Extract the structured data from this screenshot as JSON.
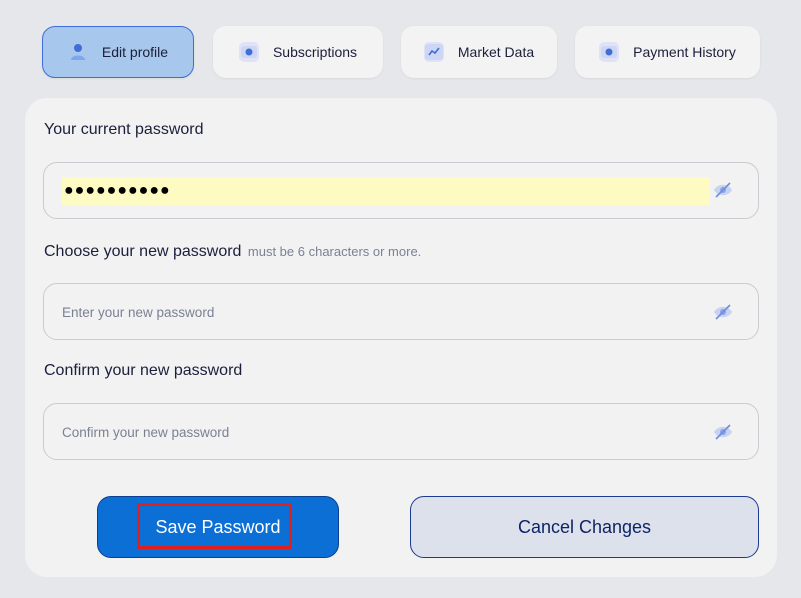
{
  "tabs": [
    {
      "label": "Edit profile",
      "icon": "user-icon",
      "active": true
    },
    {
      "label": "Subscriptions",
      "icon": "card-icon",
      "active": false
    },
    {
      "label": "Market Data",
      "icon": "chart-line-icon",
      "active": false
    },
    {
      "label": "Payment History",
      "icon": "card-icon",
      "active": false
    }
  ],
  "current": {
    "label": "Your current password",
    "masked_value": "●●●●●●●●●●"
  },
  "new": {
    "label": "Choose your new password",
    "hint": "must be 6 characters or more.",
    "placeholder": "Enter your new password"
  },
  "confirm": {
    "label": "Confirm your new password",
    "placeholder": "Confirm your new password"
  },
  "buttons": {
    "save": "Save Password",
    "cancel": "Cancel Changes"
  },
  "colors": {
    "accent": "#0b6fd6",
    "active_tab": "#a8c7ec",
    "highlight": "#e01f1f",
    "autofill": "#fdfbc2"
  }
}
